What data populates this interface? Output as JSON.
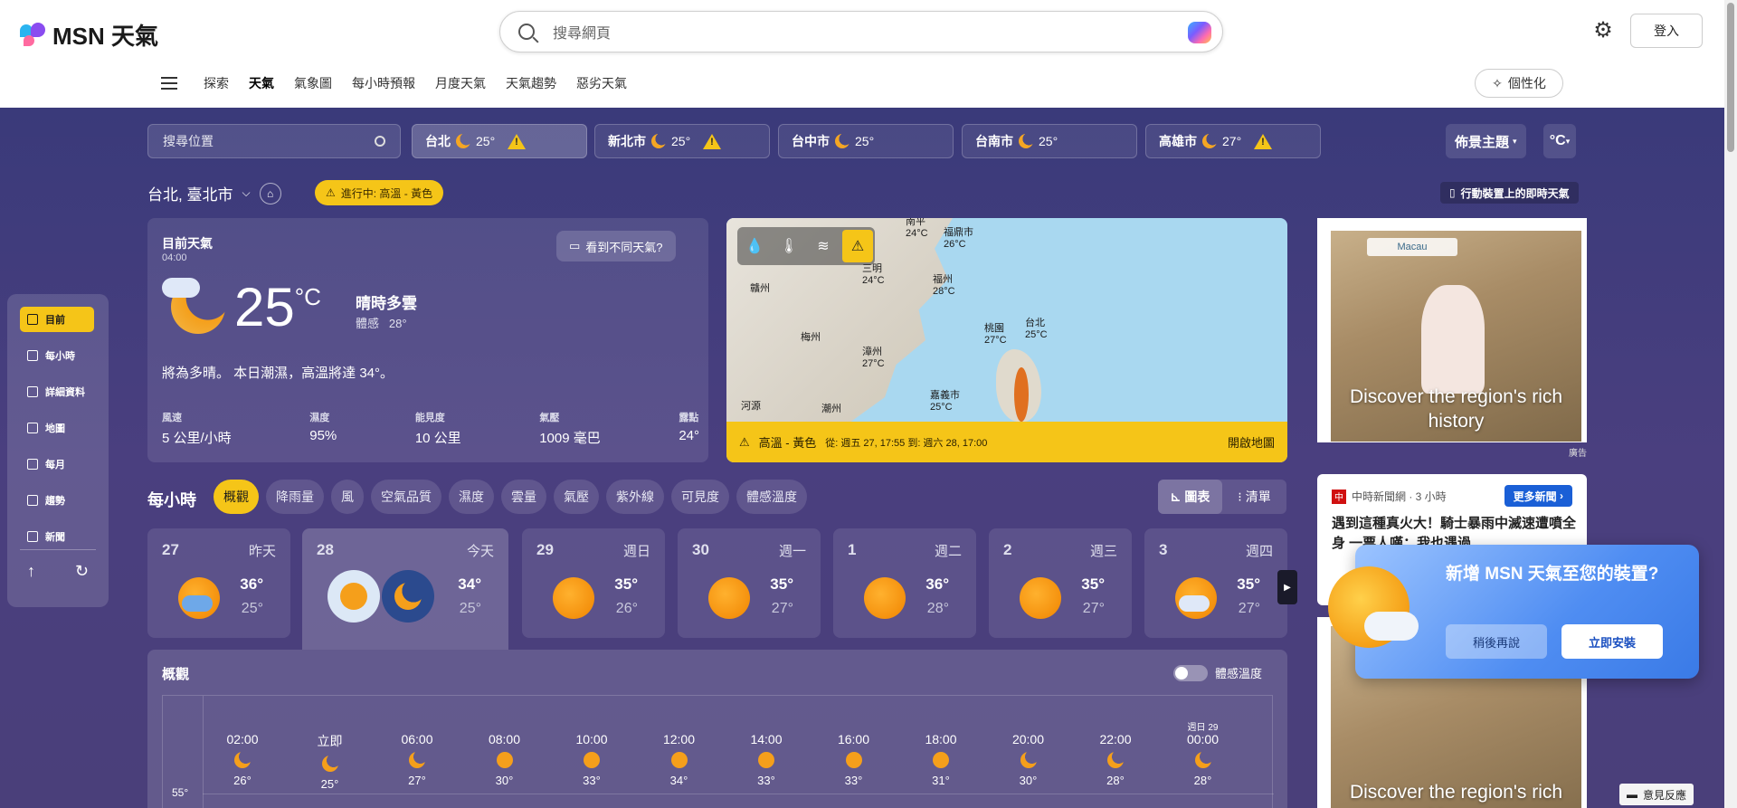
{
  "header": {
    "brand": "MSN 天氣",
    "search_placeholder": "搜尋網頁",
    "login": "登入"
  },
  "nav": {
    "items": [
      {
        "label": "探索",
        "active": false
      },
      {
        "label": "天氣",
        "active": true
      },
      {
        "label": "氣象圖",
        "active": false
      },
      {
        "label": "每小時預報",
        "active": false
      },
      {
        "label": "月度天氣",
        "active": false
      },
      {
        "label": "天氣趨勢",
        "active": false
      },
      {
        "label": "惡劣天氣",
        "active": false
      }
    ],
    "personalize": "個性化"
  },
  "locations": {
    "search_placeholder": "搜尋位置",
    "tabs": [
      {
        "name": "台北",
        "temp": "25°",
        "alert": true
      },
      {
        "name": "新北市",
        "temp": "25°",
        "alert": true
      },
      {
        "name": "台中市",
        "temp": "25°",
        "alert": false
      },
      {
        "name": "台南市",
        "temp": "25°",
        "alert": false
      },
      {
        "name": "高雄市",
        "temp": "27°",
        "alert": true
      }
    ],
    "theme": "佈景主題",
    "unit": "°C"
  },
  "location_bar": {
    "current": "台北, 臺北市",
    "alert": "進行中: 高溫 - 黃色",
    "mobile_link": "行動裝置上的即時天氣"
  },
  "current": {
    "title": "目前天氣",
    "time": "04:00",
    "feedback": "看到不同天氣?",
    "temp": "25",
    "unit": "°C",
    "condition": "晴時多雲",
    "feels_label": "體感",
    "feels_value": "28°",
    "summary": "將為多晴。 本日潮濕，高溫將達 34°。",
    "stats": [
      {
        "label": "風速",
        "value": "5 公里/小時"
      },
      {
        "label": "濕度",
        "value": "95%"
      },
      {
        "label": "能見度",
        "value": "10 公里"
      },
      {
        "label": "氣壓",
        "value": "1009 毫巴"
      },
      {
        "label": "露點",
        "value": "24°"
      }
    ]
  },
  "map": {
    "labels": [
      {
        "name": "南平",
        "temp": "24°C"
      },
      {
        "name": "福鼎市",
        "temp": "26°C"
      },
      {
        "name": "三明",
        "temp": "24°C"
      },
      {
        "name": "福州",
        "temp": "28°C"
      },
      {
        "name": "贛州",
        "temp": ""
      },
      {
        "name": "梅州",
        "temp": ""
      },
      {
        "name": "漳州",
        "temp": "27°C"
      },
      {
        "name": "桃園",
        "temp": "27°C"
      },
      {
        "name": "台北",
        "temp": "25°C"
      },
      {
        "name": "嘉義市",
        "temp": "25°C"
      },
      {
        "name": "河源",
        "temp": ""
      },
      {
        "name": "潮州",
        "temp": ""
      }
    ],
    "alert_title": "高溫 - 黃色",
    "alert_range": "從: 週五 27, 17:55 到: 週六 28, 17:00",
    "open": "開啟地圖"
  },
  "sidenav": {
    "items": [
      {
        "label": "目前",
        "active": true
      },
      {
        "label": "每小時",
        "active": false
      },
      {
        "label": "詳細資料",
        "active": false
      },
      {
        "label": "地圖",
        "active": false
      },
      {
        "label": "每月",
        "active": false
      },
      {
        "label": "趨勢",
        "active": false
      },
      {
        "label": "新聞",
        "active": false
      }
    ]
  },
  "hourly": {
    "title": "每小時",
    "tabs": [
      "概觀",
      "降雨量",
      "風",
      "空氣品質",
      "濕度",
      "雲量",
      "氣壓",
      "紫外線",
      "可見度",
      "體感溫度"
    ],
    "view_chart": "圖表",
    "view_list": "清單"
  },
  "days": [
    {
      "date": "27",
      "weekday": "昨天",
      "hi": "36°",
      "lo": "25°",
      "icon": "rain-sun-icon"
    },
    {
      "date": "28",
      "weekday": "今天",
      "hi": "34°",
      "lo": "25°",
      "icon": "partly-cloudy-icon"
    },
    {
      "date": "29",
      "weekday": "週日",
      "hi": "35°",
      "lo": "26°",
      "icon": "sun-icon"
    },
    {
      "date": "30",
      "weekday": "週一",
      "hi": "35°",
      "lo": "27°",
      "icon": "sun-icon"
    },
    {
      "date": "1",
      "weekday": "週二",
      "hi": "36°",
      "lo": "28°",
      "icon": "sun-icon"
    },
    {
      "date": "2",
      "weekday": "週三",
      "hi": "35°",
      "lo": "27°",
      "icon": "sun-icon"
    },
    {
      "date": "3",
      "weekday": "週四",
      "hi": "35°",
      "lo": "27°",
      "icon": "sun-cloud-icon"
    }
  ],
  "overview": {
    "title": "概觀",
    "toggle": "體感溫度",
    "y_tick": "55°",
    "hours": [
      {
        "day": "",
        "time": "02:00",
        "temp": "26°"
      },
      {
        "day": "",
        "time": "立即",
        "temp": "25°"
      },
      {
        "day": "",
        "time": "06:00",
        "temp": "27°"
      },
      {
        "day": "",
        "time": "08:00",
        "temp": "30°"
      },
      {
        "day": "",
        "time": "10:00",
        "temp": "33°"
      },
      {
        "day": "",
        "time": "12:00",
        "temp": "34°"
      },
      {
        "day": "",
        "time": "14:00",
        "temp": "33°"
      },
      {
        "day": "",
        "time": "16:00",
        "temp": "33°"
      },
      {
        "day": "",
        "time": "18:00",
        "temp": "31°"
      },
      {
        "day": "",
        "time": "20:00",
        "temp": "30°"
      },
      {
        "day": "",
        "time": "22:00",
        "temp": "28°"
      },
      {
        "day": "週日 29",
        "time": "00:00",
        "temp": "28°"
      }
    ]
  },
  "ads": {
    "tag": "Macau",
    "caption": "Discover the region's rich history",
    "label": "廣告"
  },
  "news": {
    "source": "中時新聞網 · 3 小時",
    "more": "更多新聞",
    "headline": "遇到這種真火大！騎士暴雨中滅速遭噴全身 一票人嘆：我也遇過"
  },
  "popup": {
    "title": "新增 MSN 天氣至您的裝置?",
    "later": "稍後再說",
    "install": "立即安裝"
  },
  "feedback_float": "意見反應"
}
